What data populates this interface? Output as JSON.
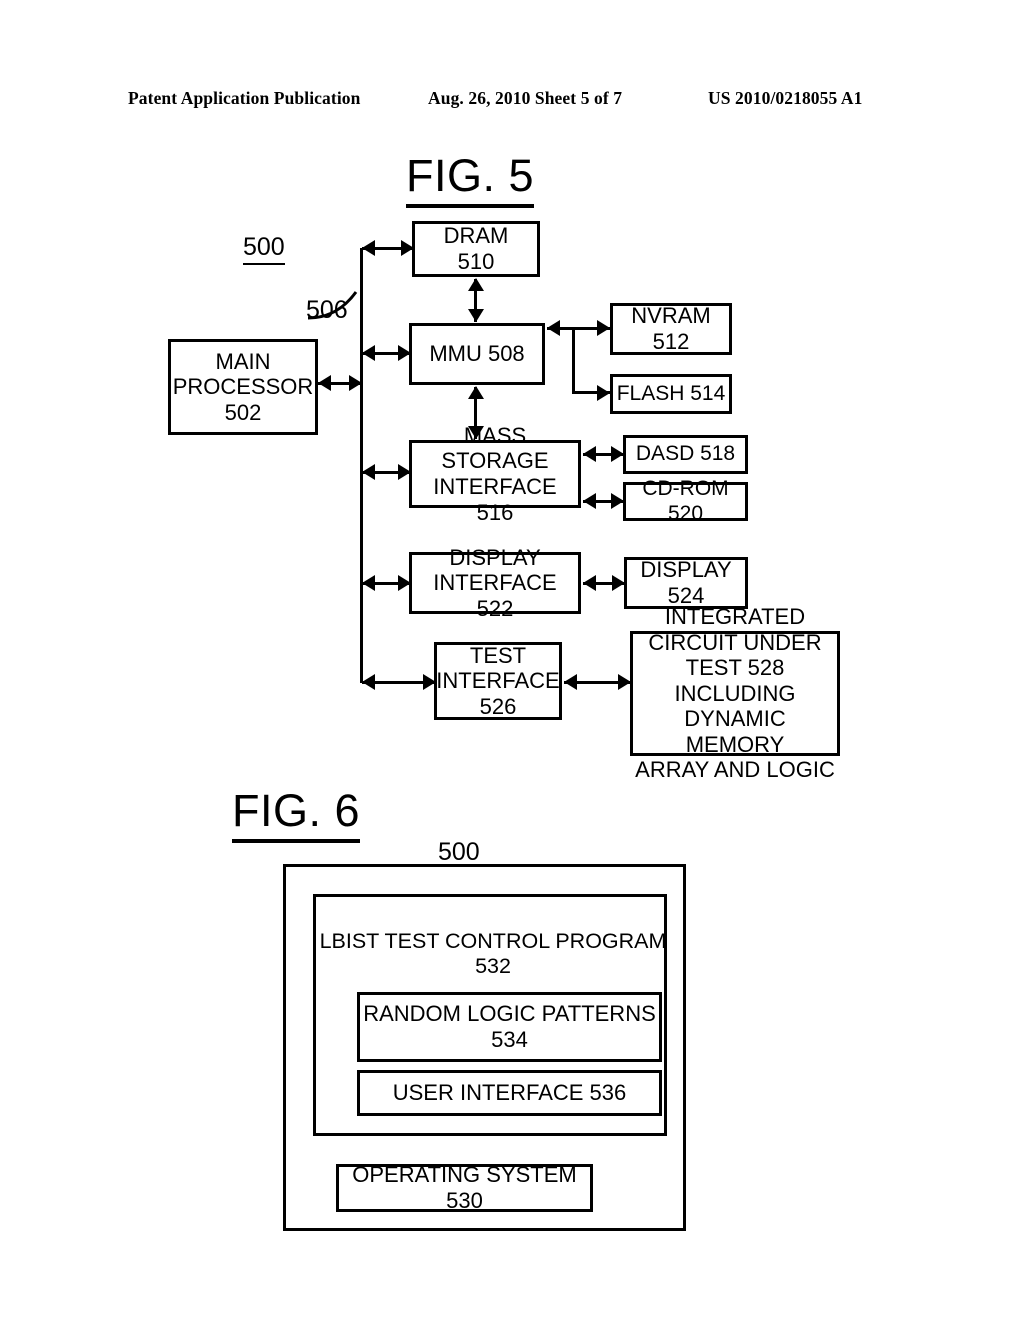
{
  "header": {
    "publication": "Patent Application Publication",
    "date_sheet": "Aug. 26, 2010  Sheet 5 of 7",
    "patent_number": "US 2010/0218055 A1"
  },
  "figures": [
    {
      "title": "FIG. 5",
      "system_label": "500",
      "bus_label": "506",
      "boxes": {
        "main_processor": "MAIN\nPROCESSOR\n502",
        "dram": "DRAM\n510",
        "mmu": "MMU 508",
        "nvram": "NVRAM\n512",
        "flash": "FLASH 514",
        "mass_storage_interface": "MASS STORAGE\nINTERFACE 516",
        "dasd": "DASD 518",
        "cdrom": "CD-ROM 520",
        "display_interface": "DISPLAY\nINTERFACE 522",
        "display": "DISPLAY\n524",
        "test_interface": "TEST\nINTERFACE\n526",
        "iut": "INTEGRATED\nCIRCUIT UNDER\nTEST 528 INCLUDING\nDYNAMIC MEMORY\nARRAY AND LOGIC"
      }
    },
    {
      "title": "FIG. 6",
      "system_label": "500",
      "boxes": {
        "lbist_program": "LBIST TEST CONTROL PROGRAM 532",
        "random_logic_patterns": "RANDOM LOGIC PATTERNS 534",
        "user_interface": "USER INTERFACE 536",
        "operating_system": "OPERATING SYSTEM 530"
      }
    }
  ],
  "colors": {
    "ink": "#000000",
    "paper": "#ffffff"
  }
}
